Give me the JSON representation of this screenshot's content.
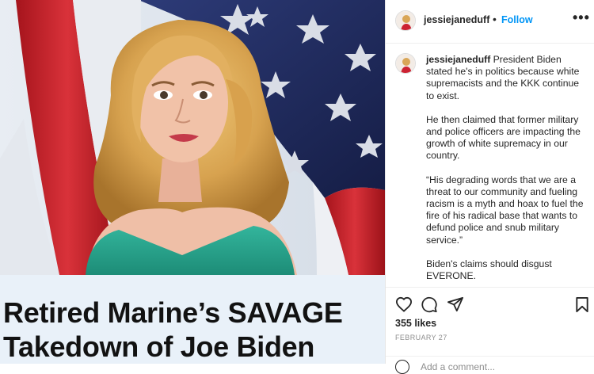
{
  "post": {
    "username": "jessiejaneduff",
    "follow_label": "Follow",
    "more_label": "•••",
    "caption_paragraphs": [
      "President Biden stated he's in politics because white supremacists and the KKK continue to exist.",
      "He then claimed that former military and police officers are impacting the growth of white supremacy in our country.",
      "“His degrading words that we are a threat to our community and fueling racism is a myth and hoax to fuel the fire of his radical base that wants to defund police and snub military service.”",
      "Biden's claims should disgust EVERONE."
    ],
    "likes": "355 likes",
    "date": "FEBRUARY 27",
    "add_comment_placeholder": "Add a comment..."
  },
  "media": {
    "headline_line1": "Retired Marine’s SAVAGE",
    "headline_line2": "Takedown of Joe Biden"
  },
  "icons": {
    "heart": "heart-icon",
    "comment": "comment-icon",
    "share": "share-icon",
    "save": "bookmark-icon",
    "more": "more-options-icon",
    "emoji": "emoji-icon"
  },
  "colors": {
    "follow": "#0095f6",
    "text": "#262626",
    "muted": "#8e8e8e",
    "headline_bg": "#e9f1f9",
    "dress": "#2aa58e",
    "flag_red": "#c4222c",
    "flag_blue": "#1f2a5c"
  }
}
